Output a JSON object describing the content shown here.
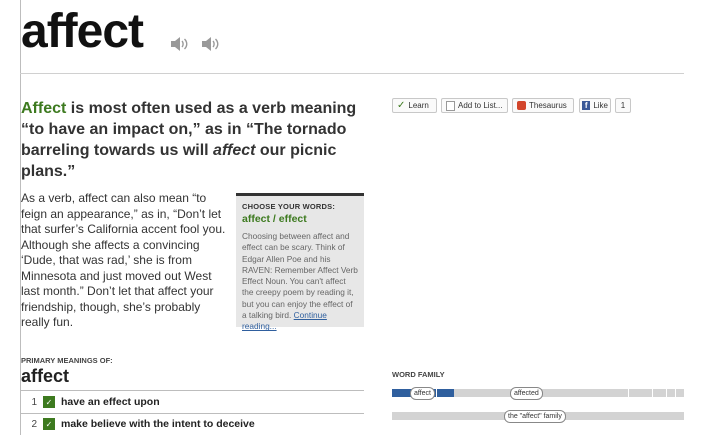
{
  "headword": "affect",
  "lead": {
    "highlight": "Affect",
    "part1": " is most often used as a verb meaning “to have an impact on,” as in “The tornado barreling towards us will ",
    "italic": "affect",
    "part2": " our picnic plans.”"
  },
  "body_text": "As a verb, affect can also mean “to feign an appearance,” as in, “Don’t let that surfer’s California accent fool you. Although she affects a convincing ‘Dude, that was rad,’ she is from Minnesota and just moved out West last month.” Don’t let that affect your friendship, though, she’s probably really fun.",
  "choose_box": {
    "kicker": "CHOOSE YOUR WORDS:",
    "title": "affect / effect",
    "text": "Choosing between affect and effect can be scary. Think of Edgar Allen Poe and his RAVEN: Remember Affect Verb Effect Noun. You can't affect the creepy poem by reading it, but you can enjoy the effect of a talking bird.",
    "link": "Continue reading..."
  },
  "tools": {
    "learn": "Learn",
    "add_to_list": "Add to List...",
    "thesaurus": "Thesaurus",
    "like": "Like",
    "like_count": "1"
  },
  "primary": {
    "kicker": "PRIMARY MEANINGS OF:",
    "word": "affect",
    "meanings": [
      {
        "num": "1",
        "text": "have an effect upon"
      },
      {
        "num": "2",
        "text": "make believe with the intent to deceive"
      }
    ]
  },
  "word_family": {
    "label": "WORD FAMILY",
    "pill_affect": "affect",
    "pill_affected": "affected",
    "pill_family": "the \"affect\" family"
  },
  "colors": {
    "green": "#3d7a1f",
    "blue_bar": "#2f5f9e"
  },
  "icons": [
    "speaker-icon",
    "checkmark-icon",
    "add-list-icon",
    "thesaurus-icon",
    "facebook-icon"
  ]
}
